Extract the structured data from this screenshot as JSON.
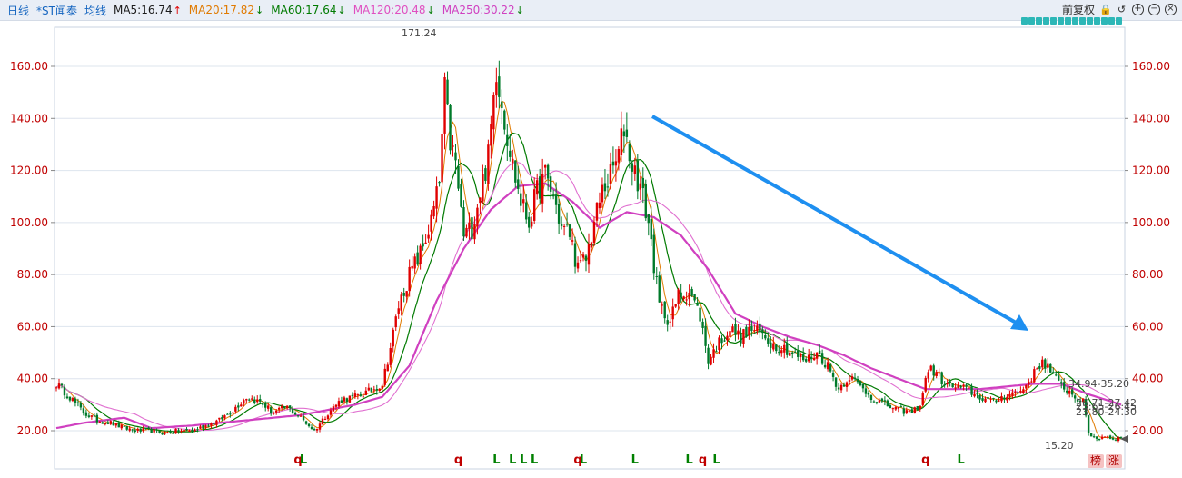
{
  "legend": {
    "period": "日线",
    "stock": "*ST闻泰",
    "avg_label": "均线",
    "items": [
      {
        "label": "MA5:16.74",
        "dir": "up",
        "color": "#1a1a1a"
      },
      {
        "label": "MA20:17.82",
        "dir": "down",
        "color": "#e07a00"
      },
      {
        "label": "MA60:17.64",
        "dir": "down",
        "color": "#007a00"
      },
      {
        "label": "MA120:20.48",
        "dir": "down",
        "color": "#e04fc0"
      },
      {
        "label": "MA250:30.22",
        "dir": "down",
        "color": "#d040c0"
      }
    ],
    "adjust_label": "前复权"
  },
  "colors": {
    "up": "#e00000",
    "down": "#007a2a",
    "arrow": "#1e8ff0",
    "ma5": "#1a1a1a",
    "ma20": "#e07a00",
    "ma60": "#007a00",
    "ma120": "#e070d0",
    "ma250": "#d040c0"
  },
  "badges": [
    "榜",
    "涨"
  ],
  "chart_data": {
    "type": "candlestick",
    "ylim": [
      14,
      177
    ],
    "y_ticks": [
      20,
      40,
      60,
      80,
      100,
      120,
      140,
      160
    ],
    "y_tick_labels": [
      "20.00",
      "40.00",
      "60.00",
      "80.00",
      "100.00",
      "120.00",
      "140.00",
      "160.00"
    ],
    "grid": true,
    "annotations": {
      "high": "171.24",
      "low": "15.20",
      "line1": "34.94-35.20",
      "line2": "26.71-27.42",
      "line3": "25.65-26.45",
      "line4": "23.80-24.30"
    },
    "price_path": [
      [
        0,
        38
      ],
      [
        5,
        33
      ],
      [
        10,
        27
      ],
      [
        15,
        24
      ],
      [
        20,
        23
      ],
      [
        25,
        21
      ],
      [
        30,
        20
      ],
      [
        35,
        20
      ],
      [
        40,
        19
      ],
      [
        45,
        20
      ],
      [
        50,
        20
      ],
      [
        55,
        22
      ],
      [
        60,
        24
      ],
      [
        65,
        28
      ],
      [
        70,
        33
      ],
      [
        75,
        31
      ],
      [
        80,
        27
      ],
      [
        85,
        29
      ],
      [
        90,
        25
      ],
      [
        95,
        20
      ],
      [
        100,
        27
      ],
      [
        105,
        32
      ],
      [
        110,
        33
      ],
      [
        115,
        35
      ],
      [
        120,
        38
      ],
      [
        123,
        52
      ],
      [
        126,
        68
      ],
      [
        130,
        80
      ],
      [
        134,
        88
      ],
      [
        138,
        100
      ],
      [
        141,
        115
      ],
      [
        143,
        150
      ],
      [
        145,
        131
      ],
      [
        147,
        122
      ],
      [
        150,
        95
      ],
      [
        153,
        98
      ],
      [
        156,
        112
      ],
      [
        159,
        125
      ],
      [
        162,
        160
      ],
      [
        165,
        140
      ],
      [
        168,
        122
      ],
      [
        171,
        108
      ],
      [
        174,
        100
      ],
      [
        177,
        112
      ],
      [
        180,
        118
      ],
      [
        183,
        110
      ],
      [
        186,
        98
      ],
      [
        189,
        96
      ],
      [
        192,
        82
      ],
      [
        195,
        86
      ],
      [
        198,
        100
      ],
      [
        201,
        112
      ],
      [
        204,
        118
      ],
      [
        207,
        126
      ],
      [
        209,
        137
      ],
      [
        212,
        122
      ],
      [
        215,
        114
      ],
      [
        218,
        100
      ],
      [
        222,
        68
      ],
      [
        226,
        62
      ],
      [
        229,
        72
      ],
      [
        233,
        74
      ],
      [
        237,
        64
      ],
      [
        240,
        47
      ],
      [
        244,
        54
      ],
      [
        248,
        59
      ],
      [
        252,
        56
      ],
      [
        256,
        59
      ],
      [
        260,
        57
      ],
      [
        264,
        53
      ],
      [
        268,
        52
      ],
      [
        272,
        49
      ],
      [
        276,
        47
      ],
      [
        280,
        50
      ],
      [
        284,
        45
      ],
      [
        288,
        36
      ],
      [
        292,
        41
      ],
      [
        296,
        37
      ],
      [
        300,
        33
      ],
      [
        305,
        30
      ],
      [
        310,
        28
      ],
      [
        315,
        27
      ],
      [
        318,
        30
      ],
      [
        321,
        44
      ],
      [
        324,
        42
      ],
      [
        327,
        38
      ],
      [
        330,
        37
      ],
      [
        335,
        36
      ],
      [
        340,
        33
      ],
      [
        345,
        31
      ],
      [
        350,
        34
      ],
      [
        355,
        35
      ],
      [
        360,
        42
      ],
      [
        363,
        47
      ],
      [
        366,
        43
      ],
      [
        369,
        38
      ],
      [
        372,
        36
      ],
      [
        375,
        33
      ],
      [
        378,
        31
      ],
      [
        380,
        19
      ],
      [
        383,
        17
      ],
      [
        386,
        18
      ],
      [
        389,
        17
      ],
      [
        392,
        17
      ]
    ],
    "ma250_path": [
      [
        0,
        21
      ],
      [
        10,
        23
      ],
      [
        25,
        25
      ],
      [
        35,
        21
      ],
      [
        50,
        22
      ],
      [
        70,
        24
      ],
      [
        90,
        26
      ],
      [
        110,
        30
      ],
      [
        120,
        33
      ],
      [
        130,
        45
      ],
      [
        140,
        70
      ],
      [
        150,
        90
      ],
      [
        160,
        105
      ],
      [
        170,
        114
      ],
      [
        180,
        115
      ],
      [
        190,
        108
      ],
      [
        200,
        98
      ],
      [
        210,
        104
      ],
      [
        220,
        102
      ],
      [
        230,
        95
      ],
      [
        240,
        82
      ],
      [
        250,
        65
      ],
      [
        260,
        60
      ],
      [
        270,
        56
      ],
      [
        280,
        53
      ],
      [
        290,
        49
      ],
      [
        300,
        44
      ],
      [
        310,
        40
      ],
      [
        320,
        36
      ],
      [
        330,
        36
      ],
      [
        340,
        36
      ],
      [
        350,
        37
      ],
      [
        360,
        38
      ],
      [
        370,
        38
      ],
      [
        380,
        34
      ],
      [
        392,
        30
      ]
    ]
  },
  "signals": [
    {
      "at": 89,
      "text": "q",
      "type": "q"
    },
    {
      "at": 91,
      "text": "L",
      "type": "L"
    },
    {
      "at": 148,
      "text": "q",
      "type": "q"
    },
    {
      "at": 162,
      "text": "L",
      "type": "L"
    },
    {
      "at": 168,
      "text": "L",
      "type": "L"
    },
    {
      "at": 172,
      "text": "L",
      "type": "L"
    },
    {
      "at": 176,
      "text": "L",
      "type": "L"
    },
    {
      "at": 192,
      "text": "q",
      "type": "q"
    },
    {
      "at": 194,
      "text": "L",
      "type": "L"
    },
    {
      "at": 213,
      "text": "L",
      "type": "L"
    },
    {
      "at": 233,
      "text": "L",
      "type": "L"
    },
    {
      "at": 238,
      "text": "q",
      "type": "q"
    },
    {
      "at": 243,
      "text": "L",
      "type": "L"
    },
    {
      "at": 320,
      "text": "q",
      "type": "q"
    },
    {
      "at": 333,
      "text": "L",
      "type": "L"
    }
  ]
}
